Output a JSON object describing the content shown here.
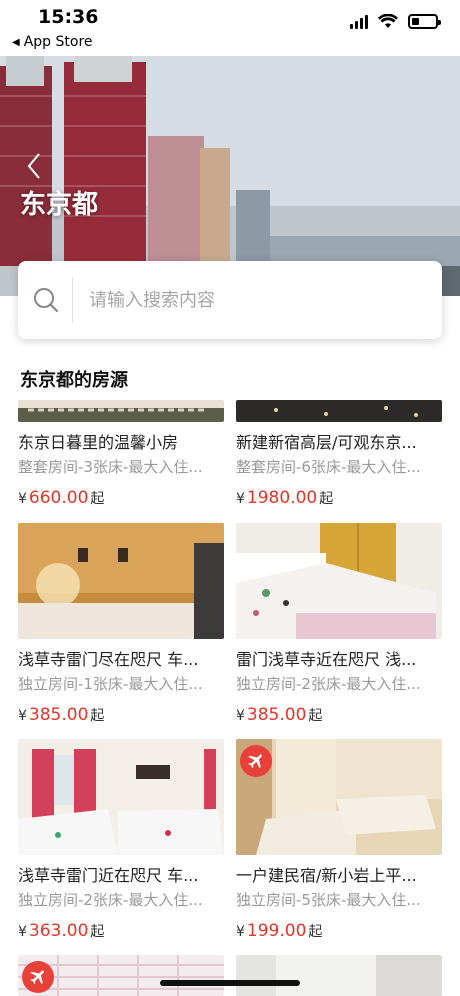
{
  "status_bar": {
    "time": "15:36",
    "back_app": "App Store"
  },
  "hero": {
    "city": "东京都"
  },
  "search": {
    "placeholder": "请输入搜索内容"
  },
  "section": {
    "title": "东京都的房源"
  },
  "currency": "¥",
  "price_suffix": "起",
  "listings": [
    {
      "name": "东京日暮里的温馨小房",
      "desc": "整套房间-3张床-最大入住...",
      "price": "660.00",
      "badge": false
    },
    {
      "name": "新建新宿高层/可观东京...",
      "desc": "整套房间-6张床-最大入住...",
      "price": "1980.00",
      "badge": false
    },
    {
      "name": "浅草寺雷门尽在咫尺 车...",
      "desc": "独立房间-1张床-最大入住...",
      "price": "385.00",
      "badge": false
    },
    {
      "name": "雷门浅草寺近在咫尺 浅...",
      "desc": "独立房间-2张床-最大入住...",
      "price": "385.00",
      "badge": false
    },
    {
      "name": "浅草寺雷门近在咫尺 车...",
      "desc": "独立房间-2张床-最大入住...",
      "price": "363.00",
      "badge": false
    },
    {
      "name": "一户建民宿/新小岩上平...",
      "desc": "独立房间-5张床-最大入住...",
      "price": "199.00",
      "badge": true
    },
    {
      "name": "",
      "desc": "",
      "price": "",
      "badge": true
    },
    {
      "name": "",
      "desc": "",
      "price": "",
      "badge": false
    }
  ],
  "colors": {
    "price": "#e5352b",
    "badge": "#e8413a"
  },
  "icons": {
    "search": "search-icon",
    "back": "chevron-left-icon",
    "plane": "airplane-icon"
  }
}
